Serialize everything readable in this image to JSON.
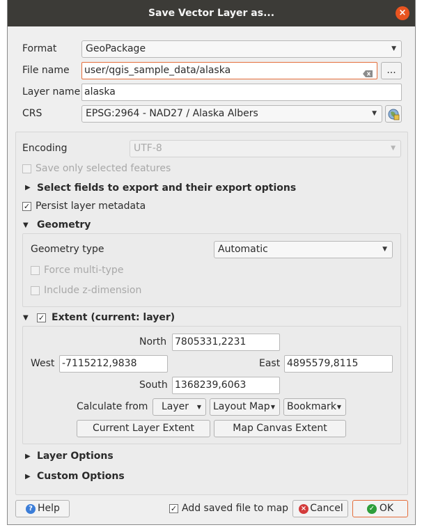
{
  "window": {
    "title": "Save Vector Layer as...",
    "close_glyph": "×"
  },
  "format": {
    "label": "Format",
    "value": "GeoPackage"
  },
  "file_name": {
    "label": "File name",
    "value": "user/qgis_sample_data/alaska",
    "browse_label": "..."
  },
  "layer_name": {
    "label": "Layer name",
    "value": "alaska"
  },
  "crs": {
    "label": "CRS",
    "value": "EPSG:2964 - NAD27 / Alaska Albers"
  },
  "encoding": {
    "label": "Encoding",
    "value": "UTF-8"
  },
  "save_only_selected": {
    "label": "Save only selected features",
    "checked": false
  },
  "select_fields": {
    "label": "Select fields to export and their export options"
  },
  "persist_metadata": {
    "label": "Persist layer metadata",
    "checked": true
  },
  "geometry": {
    "label": "Geometry",
    "type_label": "Geometry type",
    "type_value": "Automatic",
    "force_multi_label": "Force multi-type",
    "include_z_label": "Include z-dimension"
  },
  "extent": {
    "label": "Extent (current: layer)",
    "north_label": "North",
    "north_value": "7805331,2231",
    "west_label": "West",
    "west_value": "-7115212,9838",
    "east_label": "East",
    "east_value": "4895579,8115",
    "south_label": "South",
    "south_value": "1368239,6063",
    "calculate_from_label": "Calculate from",
    "layer_btn": "Layer",
    "layout_map_btn": "Layout Map",
    "bookmark_btn": "Bookmark",
    "current_layer_extent_btn": "Current Layer Extent",
    "map_canvas_extent_btn": "Map Canvas Extent"
  },
  "layer_options": {
    "label": "Layer Options"
  },
  "custom_options": {
    "label": "Custom Options"
  },
  "footer": {
    "help_label": "Help",
    "add_to_map_label": "Add saved file to map",
    "cancel_label": "Cancel",
    "ok_label": "OK"
  },
  "colors": {
    "titlebar": "#3c3b37",
    "close": "#e95420",
    "help_icon": "#3b7dd8",
    "cancel_icon": "#d33b3b",
    "ok_icon": "#2e9e3a",
    "focus": "#e46d3a"
  }
}
